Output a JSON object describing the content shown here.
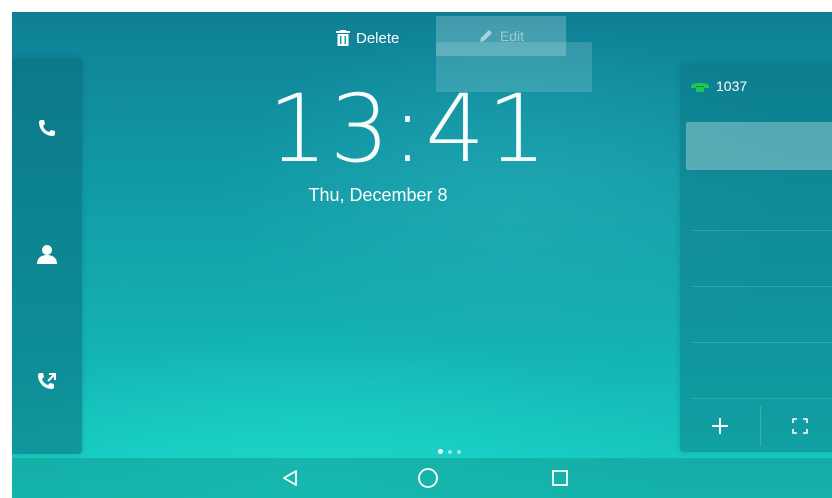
{
  "top_menu": {
    "delete_label": "Delete",
    "edit_label": "Edit",
    "delete_icon": "trash-icon",
    "edit_icon": "pencil-icon"
  },
  "clock": {
    "time": "13:41",
    "date": "Thu, December 8"
  },
  "left_panel": {
    "items": [
      {
        "icon": "phone-icon"
      },
      {
        "icon": "contact-icon"
      },
      {
        "icon": "call-history-icon"
      }
    ]
  },
  "right_panel": {
    "line_key_label": "1037",
    "line_key_icon": "phone-handset-icon",
    "line_icon_color": "#1ec84a",
    "add_icon": "plus-icon",
    "expand_icon": "fullscreen-icon"
  },
  "pagination": {
    "pages": 3,
    "current": 1
  },
  "navbar": {
    "icons": [
      "back-icon",
      "home-icon",
      "recents-icon"
    ]
  },
  "colors": {
    "background_top": "#0f7f95",
    "background_bottom": "#18cfc2"
  }
}
